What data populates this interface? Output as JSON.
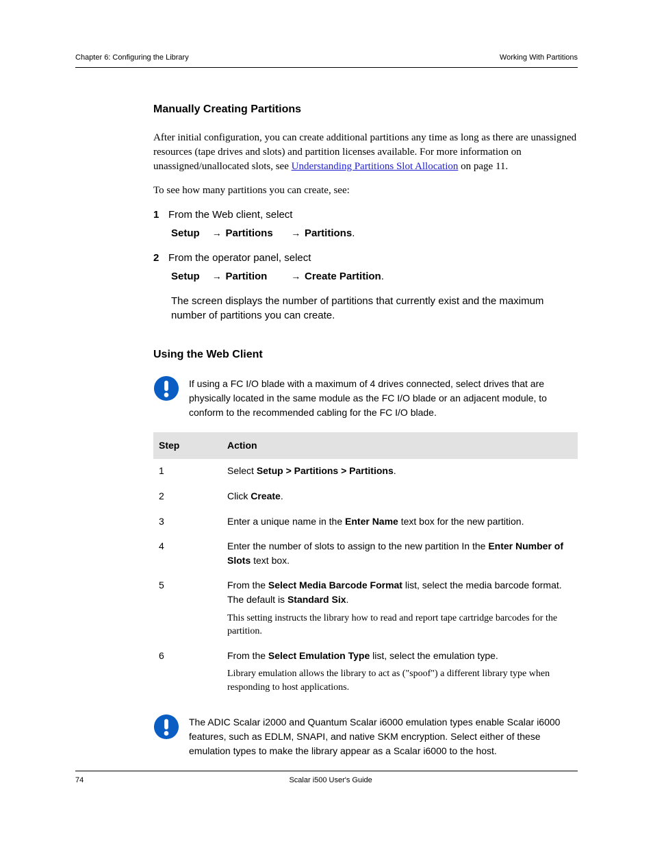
{
  "header": {
    "left": "Chapter 6: Configuring the Library",
    "right": "Working With Partitions"
  },
  "sections": {
    "s1": {
      "title": "Manually Creating Partitions",
      "p1_prefix": "After initial configuration, you can create additional partitions any time as long as there are unassigned resources (tape drives and slots) and partition licenses available. For more information on unassigned/unallocated slots, see ",
      "p1_link": "Understanding Partitions Slot Allocation",
      "p1_suffix": " on page 11.",
      "p2": "To see how many partitions you can create, see:",
      "step1a": "From the Web client, select ",
      "step1b_a": "Setup",
      "step1b_b": "Partitions",
      "step1b_c": "Partitions",
      "step1c": ".",
      "step2a": "From the operator panel, select ",
      "step2b_a": "Setup",
      "step2b_b": "Partition",
      "step2b_c": "Create Partition",
      "step2c": ".",
      "p3": "The screen displays the number of partitions that currently exist and the maximum number of partitions you can create."
    },
    "s2": {
      "title": "Using the Web Client",
      "notice1": "If using a FC I/O blade with a maximum of 4 drives connected, select drives that are physically located in the same module as the FC I/O blade or an adjacent module, to conform to the recommended cabling for the FC I/O blade.",
      "table": {
        "h1": "Step",
        "h2": "Action",
        "r1": {
          "step": "1",
          "actionA": "Select ",
          "bold1": "Setup > Partitions > Partitions",
          "actionB": "."
        },
        "r2": {
          "step": "2",
          "actionA": "Click ",
          "bold1": "Create",
          "actionB": "."
        },
        "r3": {
          "step": "3",
          "actionA": "Enter a unique name in the ",
          "bold1": "Enter Name",
          "actionB": " text box for the new partition."
        },
        "r4": {
          "step": "4",
          "actionA": "Enter the number of slots to assign to the new partition In the ",
          "bold1": "Enter Number of Slots",
          "actionB": " text box."
        },
        "r5": {
          "step": "5",
          "actionPrefix": "From the ",
          "bold1": "Select Media Barcode Format",
          "actionMid": " list, select the media barcode format. The default is ",
          "bold2": "Standard Six",
          "actionSuffix": "."
        },
        "r5_note": "This setting instructs the library how to read and report tape cartridge barcodes for the partition.",
        "r6": {
          "step": "6",
          "actionA": "From the ",
          "bold1": "Select Emulation Type",
          "actionB": " list, select the emulation type."
        },
        "r6_note": "Library emulation allows the library to act as (\"spoof\") a different library type when responding to host applications."
      },
      "notice2a": "The ADIC Scalar i2000 and Quantum Scalar i6000 emulation types enable ",
      "notice2b": "Scalar i6000 features, such as EDLM, SNAPI, and native SKM encryption. Select either of these emulation types to make the library appear as a Scalar i6000 to the host."
    }
  },
  "footer": {
    "left": "74",
    "center": "Scalar i500 User's Guide"
  }
}
